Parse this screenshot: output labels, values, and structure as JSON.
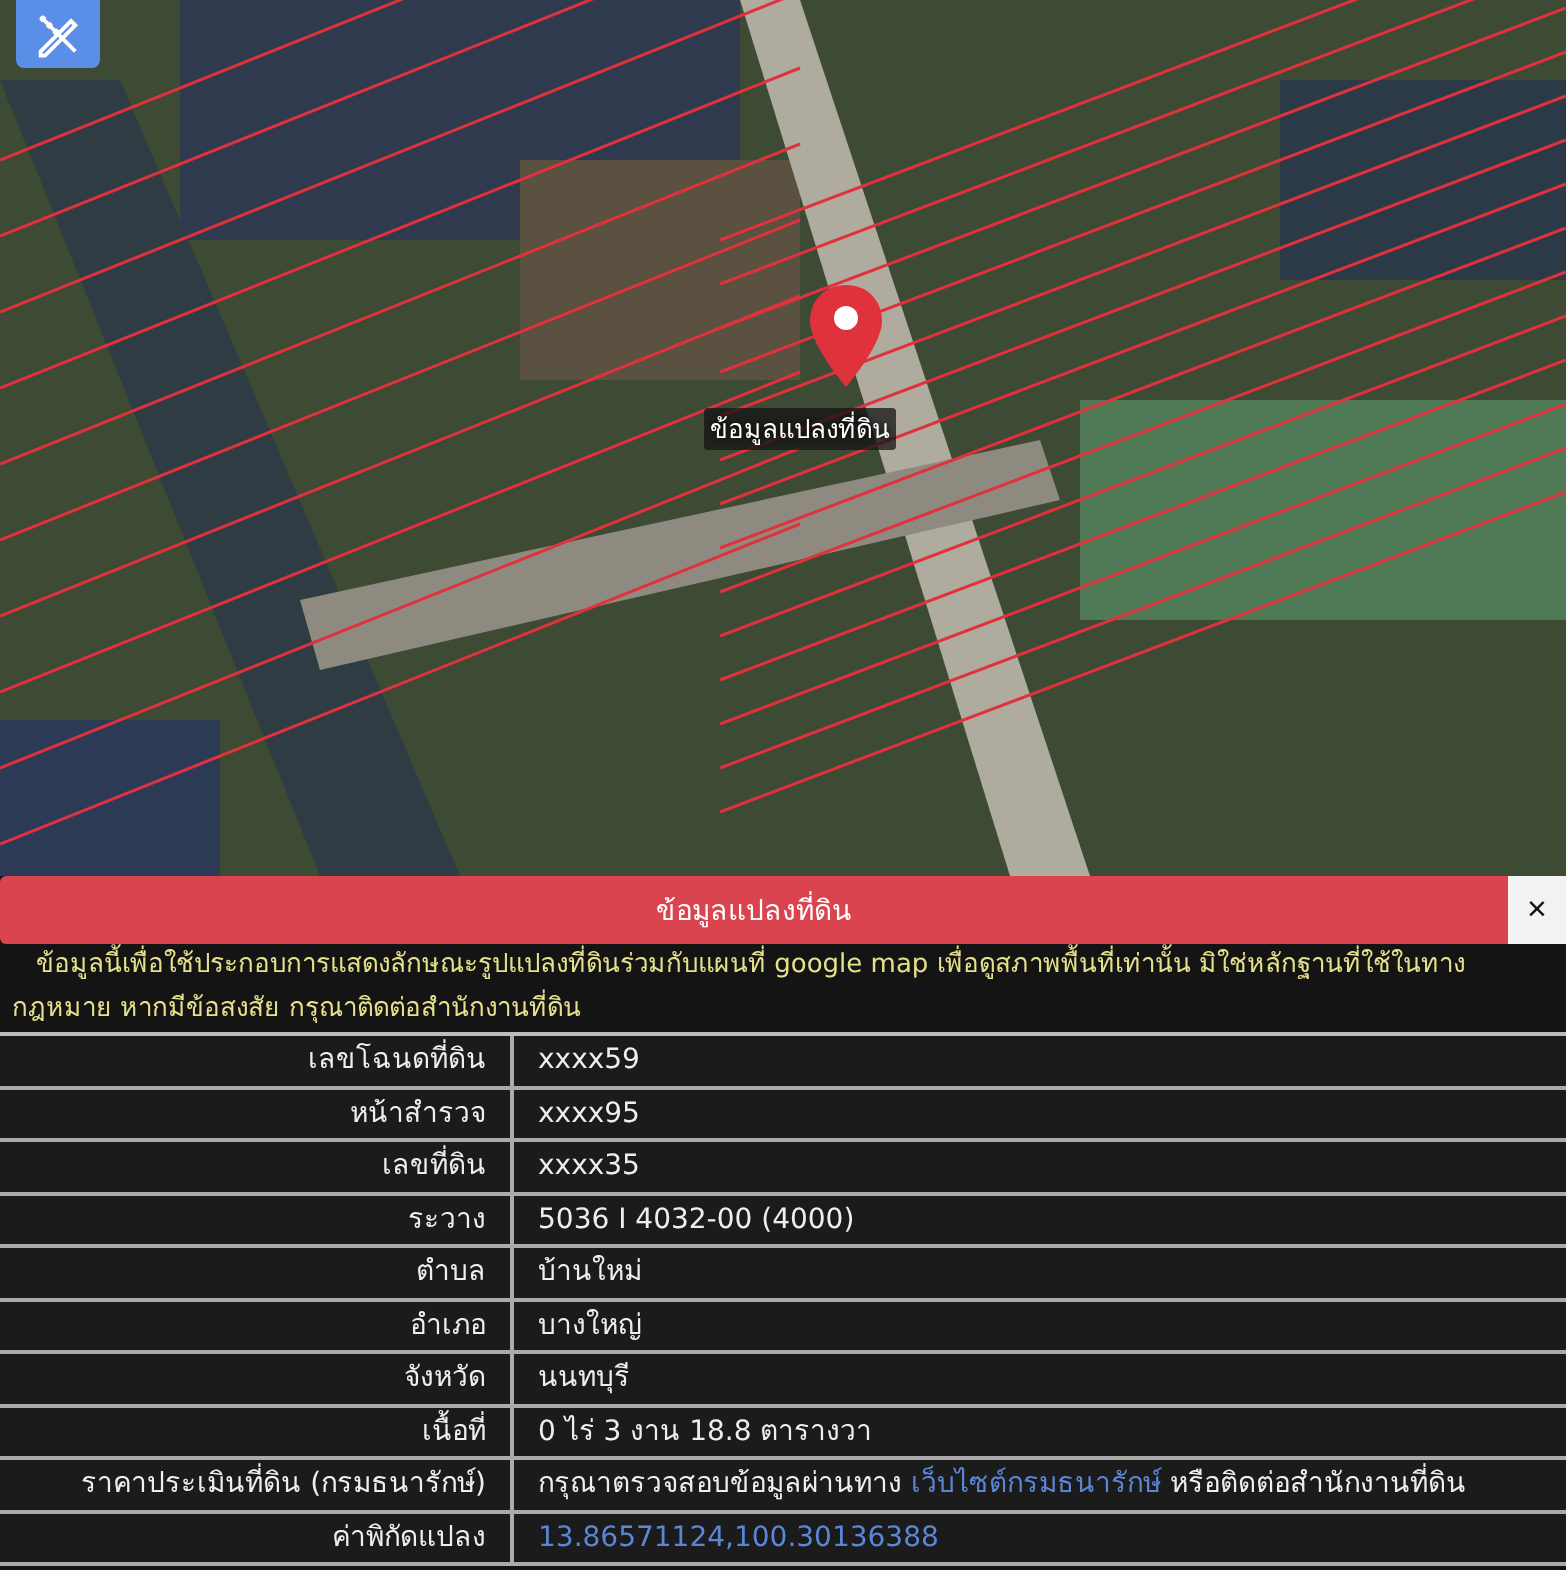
{
  "map": {
    "pin_label": "ข้อมูลแปลงที่ดิน"
  },
  "panel": {
    "title": "ข้อมูลแปลงที่ดิน",
    "close": "×",
    "notice": "ข้อมูลนี้เพื่อใช้ประกอบการแสดงลักษณะรูปแปลงที่ดินร่วมกับแผนที่ google map เพื่อดูสภาพพื้นที่เท่านั้น มิใช่หลักฐานที่ใช้ในทางกฎหมาย หากมีข้อสงสัย กรุณาติดต่อสำนักงานที่ดิน",
    "rows": [
      {
        "label": "เลขโฉนดที่ดิน",
        "kind": "text",
        "value": "xxxx59"
      },
      {
        "label": "หน้าสำรวจ",
        "kind": "text",
        "value": "xxxx95"
      },
      {
        "label": "เลขที่ดิน",
        "kind": "text",
        "value": "xxxx35"
      },
      {
        "label": "ระวาง",
        "kind": "text",
        "value": "5036 I 4032-00 (4000)"
      },
      {
        "label": "ตำบล",
        "kind": "text",
        "value": "บ้านใหม่"
      },
      {
        "label": "อำเภอ",
        "kind": "text",
        "value": "บางใหญ่"
      },
      {
        "label": "จังหวัด",
        "kind": "text",
        "value": "นนทบุรี"
      },
      {
        "label": "เนื้อที่",
        "kind": "text",
        "value": "0 ไร่ 3 งาน 18.8 ตารางวา"
      },
      {
        "label": "ราคาประเมินที่ดิน (กรมธนารักษ์)",
        "kind": "mixed",
        "before": "กรุณาตรวจสอบข้อมูลผ่านทาง ",
        "link": "เว็บไซต์กรมธนารักษ์",
        "after": " หรือติดต่อสำนักงานที่ดิน"
      },
      {
        "label": "ค่าพิกัดแปลง",
        "kind": "link",
        "value": "13.86571124,100.30136388"
      }
    ]
  }
}
